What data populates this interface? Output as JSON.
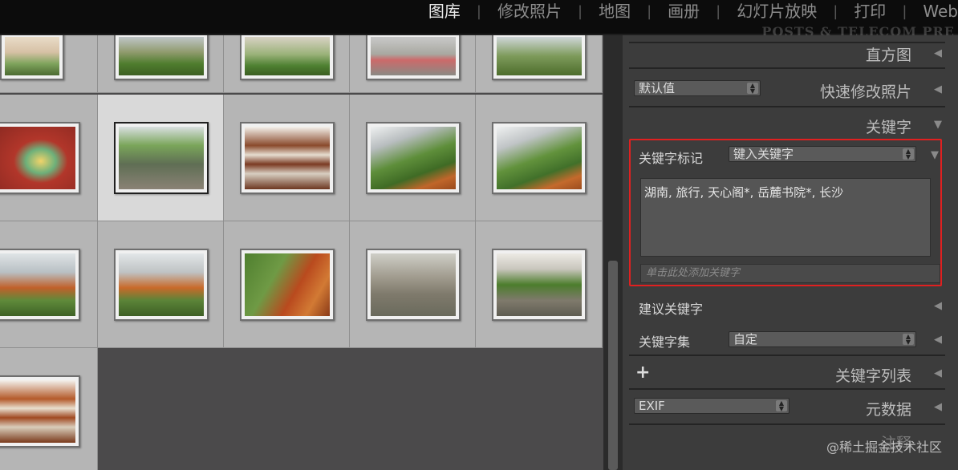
{
  "modules": {
    "items": [
      "图库",
      "修改照片",
      "地图",
      "画册",
      "幻灯片放映",
      "打印",
      "Web"
    ],
    "active": "图库"
  },
  "watermark_top": "POSTS & TELECOM PRE",
  "watermark_bottom": "@稀土掘金技术社区",
  "panel": {
    "histogram": "直方图",
    "quick_develop": {
      "preset_value": "默认值",
      "title": "快速修改照片"
    },
    "keywording": {
      "title": "关键字",
      "tags_label": "关键字标记",
      "tags_dropdown": "键入关键字",
      "keywords_text": "湖南, 旅行, 天心阁*, 岳麓书院*, 长沙",
      "add_placeholder": "单击此处添加关键字",
      "suggestions": "建议关键字",
      "set_label": "关键字集",
      "set_value": "自定"
    },
    "keyword_list": "关键字列表",
    "metadata": {
      "preset_value": "EXIF",
      "title": "元数据"
    },
    "comments": "注释"
  },
  "colors": {
    "highlight_border": "#e02020",
    "topbar": "#0c0c0c",
    "panel_bg": "#3c3c3c",
    "grid_cell": "#b5b5b5"
  }
}
